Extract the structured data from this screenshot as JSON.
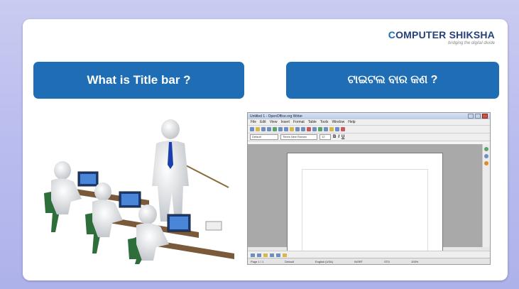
{
  "logo": {
    "brand_c": "C",
    "brand_rest": "OMPUTER SHIKSHA",
    "tagline": "bridging the digital divide"
  },
  "left_button": {
    "label": "What is Title bar ?"
  },
  "right_button": {
    "label": "ଟାଇଟଲ ବାର କଣ ?"
  },
  "screenshot": {
    "title": "Untitled 1 - OpenOffice.org Writer",
    "menu": [
      "File",
      "Edit",
      "View",
      "Insert",
      "Format",
      "Table",
      "Tools",
      "Window",
      "Help"
    ],
    "style_box": "Default",
    "font_box": "Times New Roman",
    "size_box": "12",
    "status": [
      "Page 1 / 1",
      "Default",
      "English (USA)",
      "INSRT",
      "STD",
      "100%"
    ]
  },
  "colors": {
    "accent": "#1f6db4",
    "background": "#b9bcee"
  }
}
